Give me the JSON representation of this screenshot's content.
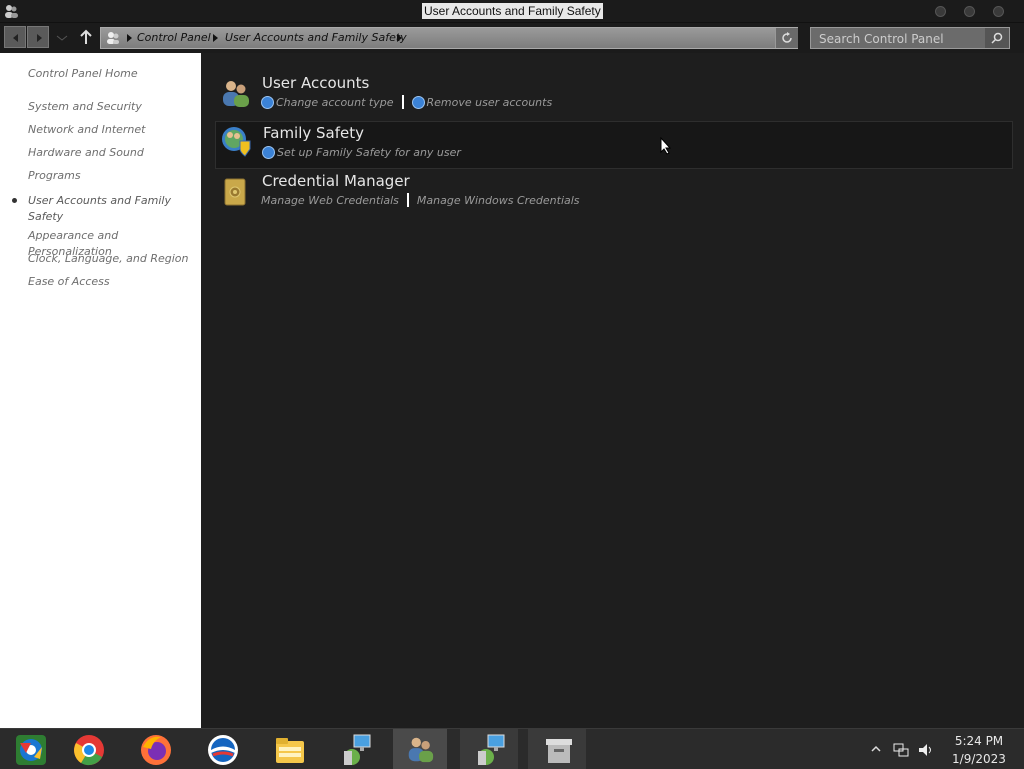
{
  "window": {
    "title": "User Accounts and Family Safety"
  },
  "nav": {
    "breadcrumb": [
      "Control Panel",
      "User Accounts and Family Safety"
    ],
    "search_placeholder": "Search Control Panel"
  },
  "sidebar": {
    "home": "Control Panel Home",
    "items": [
      {
        "label": "System and Security"
      },
      {
        "label": "Network and Internet"
      },
      {
        "label": "Hardware and Sound"
      },
      {
        "label": "Programs"
      },
      {
        "label": "User Accounts and Family Safety",
        "selected": true
      },
      {
        "label": "Appearance and Personalization"
      },
      {
        "label": "Clock, Language, and Region"
      },
      {
        "label": "Ease of Access"
      }
    ]
  },
  "categories": [
    {
      "title": "User Accounts",
      "icon": "users-icon",
      "links": [
        "Change account type",
        "Remove user accounts"
      ]
    },
    {
      "title": "Family Safety",
      "icon": "family-safety-icon",
      "links": [
        "Set up Family Safety for any user"
      ]
    },
    {
      "title": "Credential Manager",
      "icon": "vault-icon",
      "links": [
        "Manage Web Credentials",
        "Manage Windows Credentials"
      ]
    }
  ],
  "taskbar": {
    "apps": [
      "chromium-icon",
      "chrome-icon",
      "firefox-icon",
      "opera-icon",
      "file-explorer-icon",
      "network-monitor-icon",
      "control-panel-icon",
      "network-monitor-icon",
      "archive-icon"
    ],
    "time": "5:24 PM",
    "date": "1/9/2023"
  },
  "colors": {
    "background": "#1e1e1e",
    "sidebar": "#ffffff",
    "taskbar": "#2b2b2b",
    "link": "#9a9a9a"
  }
}
